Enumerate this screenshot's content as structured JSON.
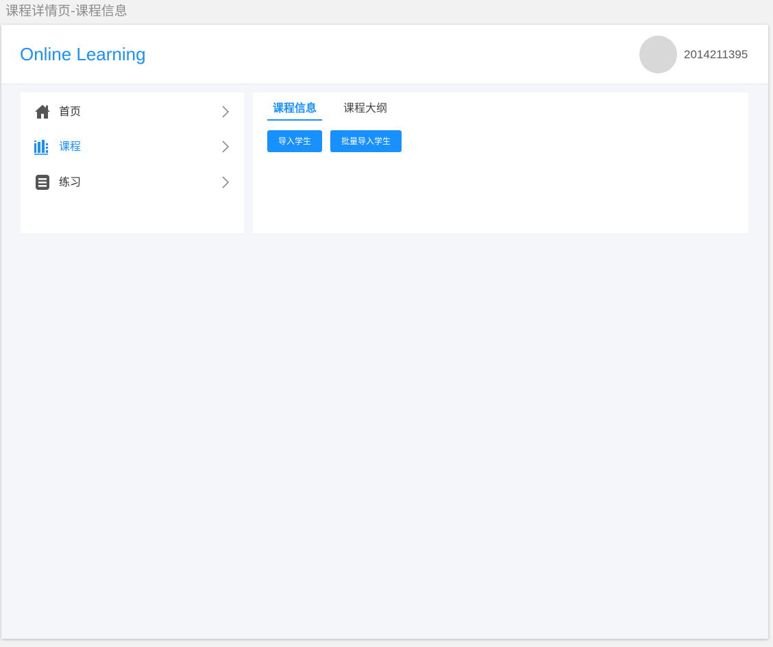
{
  "page_caption": "课程详情页-课程信息",
  "header": {
    "logo": "Online Learning",
    "user_id": "2014211395"
  },
  "sidebar": {
    "items": [
      {
        "label": "首页",
        "icon": "home-icon",
        "active": false
      },
      {
        "label": "课程",
        "icon": "books-icon",
        "active": true
      },
      {
        "label": "练习",
        "icon": "list-icon",
        "active": false
      }
    ]
  },
  "content": {
    "tabs": [
      {
        "label": "课程信息",
        "active": true
      },
      {
        "label": "课程大纲",
        "active": false
      }
    ],
    "buttons": {
      "import_students": "导入学生",
      "batch_import_students": "批量导入学生"
    }
  },
  "colors": {
    "accent": "#1890ff",
    "background": "#f4f6fa",
    "text": "#333333",
    "icon_gray": "#555555"
  }
}
